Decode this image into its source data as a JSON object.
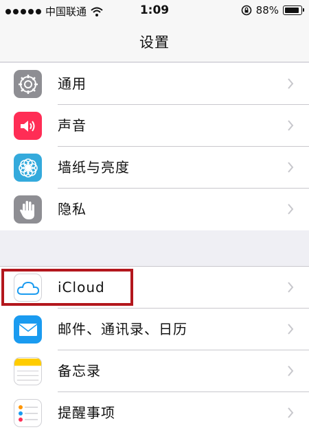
{
  "status": {
    "carrier": "中国联通",
    "time": "1:09",
    "battery": "88%",
    "battery_level": 0.88
  },
  "nav": {
    "title": "设置"
  },
  "group1": [
    {
      "label": "通用",
      "icon": "gear-icon",
      "color": "#8e8e93"
    },
    {
      "label": "声音",
      "icon": "speaker-icon",
      "color": "#ff2d55"
    },
    {
      "label": "墙纸与亮度",
      "icon": "flower-icon",
      "color": "#34aadc"
    },
    {
      "label": "隐私",
      "icon": "hand-icon",
      "color": "#8e8e93"
    }
  ],
  "group2": [
    {
      "label": "iCloud",
      "icon": "cloud-icon",
      "color": "#ffffff"
    },
    {
      "label": "邮件、通讯录、日历",
      "icon": "envelope-icon",
      "color": "#1a9bf0"
    },
    {
      "label": "备忘录",
      "icon": "notes-icon",
      "color": "#ffcc00"
    },
    {
      "label": "提醒事项",
      "icon": "reminders-icon",
      "color": "#ffffff"
    }
  ],
  "colors": {
    "highlight": "#b3171d",
    "background": "#efeff4"
  }
}
